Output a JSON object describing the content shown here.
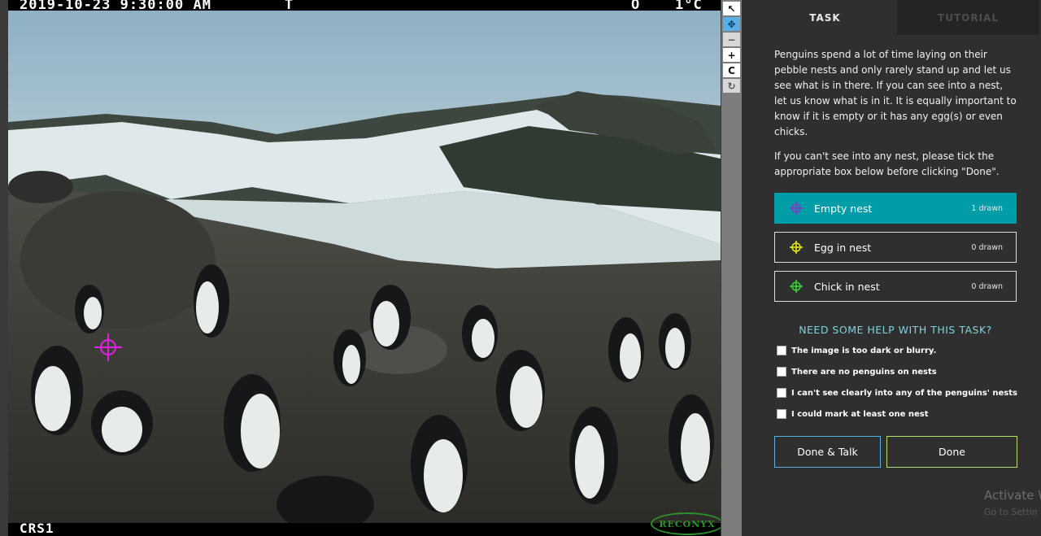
{
  "camera": {
    "timestamp": "2019-10-23 9:30:00 AM",
    "temp_icon": "T",
    "moon_icon": "O",
    "temperature": "1°C",
    "camera_id": "CRS1",
    "brand": "RECONYX"
  },
  "toolbar": {
    "items": [
      {
        "icon": "pointer-icon",
        "glyph": "↖"
      },
      {
        "icon": "move-icon",
        "glyph": "✥"
      },
      {
        "icon": "zoom-out-icon",
        "glyph": "−"
      },
      {
        "icon": "zoom-in-icon",
        "glyph": "+"
      },
      {
        "icon": "rotate-icon",
        "glyph": "C"
      },
      {
        "icon": "reset-icon",
        "glyph": "↻"
      }
    ]
  },
  "tabs": {
    "task": "TASK",
    "tutorial": "TUTORIAL"
  },
  "instructions": {
    "p1": "Penguins spend a lot of time laying on their pebble nests and only rarely stand up and let us see what is in there. If you can see into a nest, let us know what is in it. It is equally important to know if it is empty or it has any egg(s) or even chicks.",
    "p2": "If you can't see into any nest, please tick the appropriate box below before clicking \"Done\"."
  },
  "tools": [
    {
      "label": "Empty nest",
      "count": "1 drawn",
      "color": "#7b3fc4",
      "selected": true
    },
    {
      "label": "Egg in nest",
      "count": "0 drawn",
      "color": "#e6e61a",
      "selected": false
    },
    {
      "label": "Chick in nest",
      "count": "0 drawn",
      "color": "#35d435",
      "selected": false
    }
  ],
  "help": {
    "title": "NEED SOME HELP WITH THIS TASK?",
    "options": [
      "The image is too dark or blurry.",
      "There are no penguins on nests",
      "I can't see clearly into any of the penguins' nests",
      "I could mark at least one nest"
    ]
  },
  "buttons": {
    "done_talk": "Done & Talk",
    "done": "Done"
  },
  "watermark": {
    "title": "Activate W",
    "sub": "Go to Settin"
  },
  "colors": {
    "accent": "#009ca8",
    "help": "#7fd3e0",
    "done_talk_border": "#5ab0e6",
    "done_border": "#b3df74",
    "marker": "#e020e0"
  }
}
